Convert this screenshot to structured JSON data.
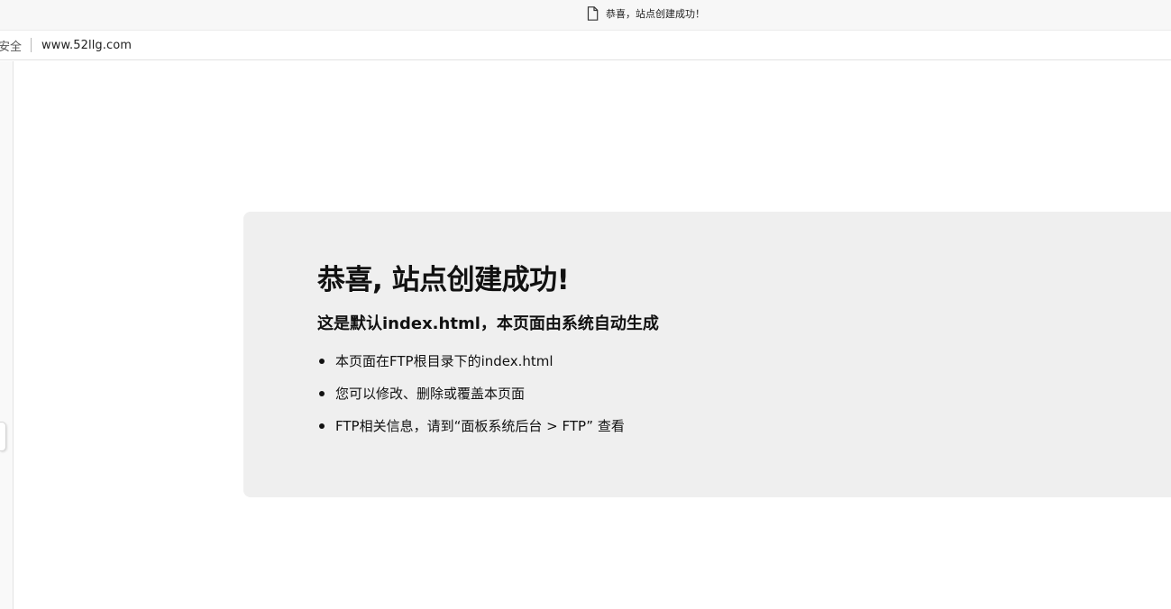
{
  "browser": {
    "tab_title": "恭喜，站点创建成功！",
    "tab_icon": "document-icon",
    "security_label": "安全",
    "url": "www.52llg.com"
  },
  "page": {
    "heading": "恭喜, 站点创建成功!",
    "subheading": "这是默认index.html，本页面由系统自动生成",
    "items": [
      "本页面在FTP根目录下的index.html",
      "您可以修改、删除或覆盖本页面",
      "FTP相关信息，请到“面板系统后台 > FTP” 查看"
    ]
  },
  "colors": {
    "panel_background": "#efefef",
    "text": "#111111"
  }
}
